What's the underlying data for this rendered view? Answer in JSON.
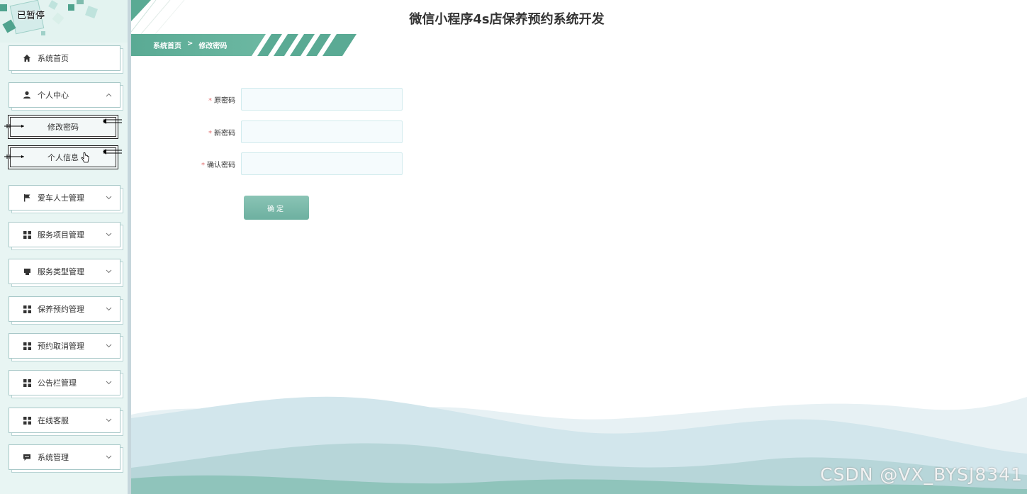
{
  "overlay": {
    "paused": "已暂停"
  },
  "header": {
    "title": "微信小程序4s店保养预约系统开发"
  },
  "breadcrumb": {
    "home": "系统首页",
    "sep": ">",
    "current": "修改密码"
  },
  "sidebar": {
    "items": [
      {
        "label": "系统首页",
        "icon": "home-icon"
      },
      {
        "label": "个人中心",
        "icon": "user-icon",
        "arrow": "^",
        "children": [
          {
            "label": "修改密码"
          },
          {
            "label": "个人信息"
          }
        ]
      },
      {
        "label": "爱车人士管理",
        "icon": "flag-icon",
        "arrow": "v"
      },
      {
        "label": "服务项目管理",
        "icon": "grid-icon",
        "arrow": "v"
      },
      {
        "label": "服务类型管理",
        "icon": "bookmark-icon",
        "arrow": "v"
      },
      {
        "label": "保养预约管理",
        "icon": "grid-icon",
        "arrow": "v"
      },
      {
        "label": "预约取消管理",
        "icon": "grid-icon",
        "arrow": "v"
      },
      {
        "label": "公告栏管理",
        "icon": "grid-icon",
        "arrow": "v"
      },
      {
        "label": "在线客服",
        "icon": "grid-icon",
        "arrow": "v"
      },
      {
        "label": "系统管理",
        "icon": "chat-icon",
        "arrow": "v"
      }
    ]
  },
  "form": {
    "fields": [
      {
        "required": "*",
        "label": "原密码",
        "value": ""
      },
      {
        "required": "*",
        "label": "新密码",
        "value": ""
      },
      {
        "required": "*",
        "label": "确认密码",
        "value": ""
      }
    ],
    "submit_label": "确定"
  },
  "watermark": "CSDN @VX_BYSJ8341",
  "colors": {
    "accent": "#5aaa94",
    "sidebar_bg": "#e8f5f3",
    "required": "#e06c6c"
  }
}
